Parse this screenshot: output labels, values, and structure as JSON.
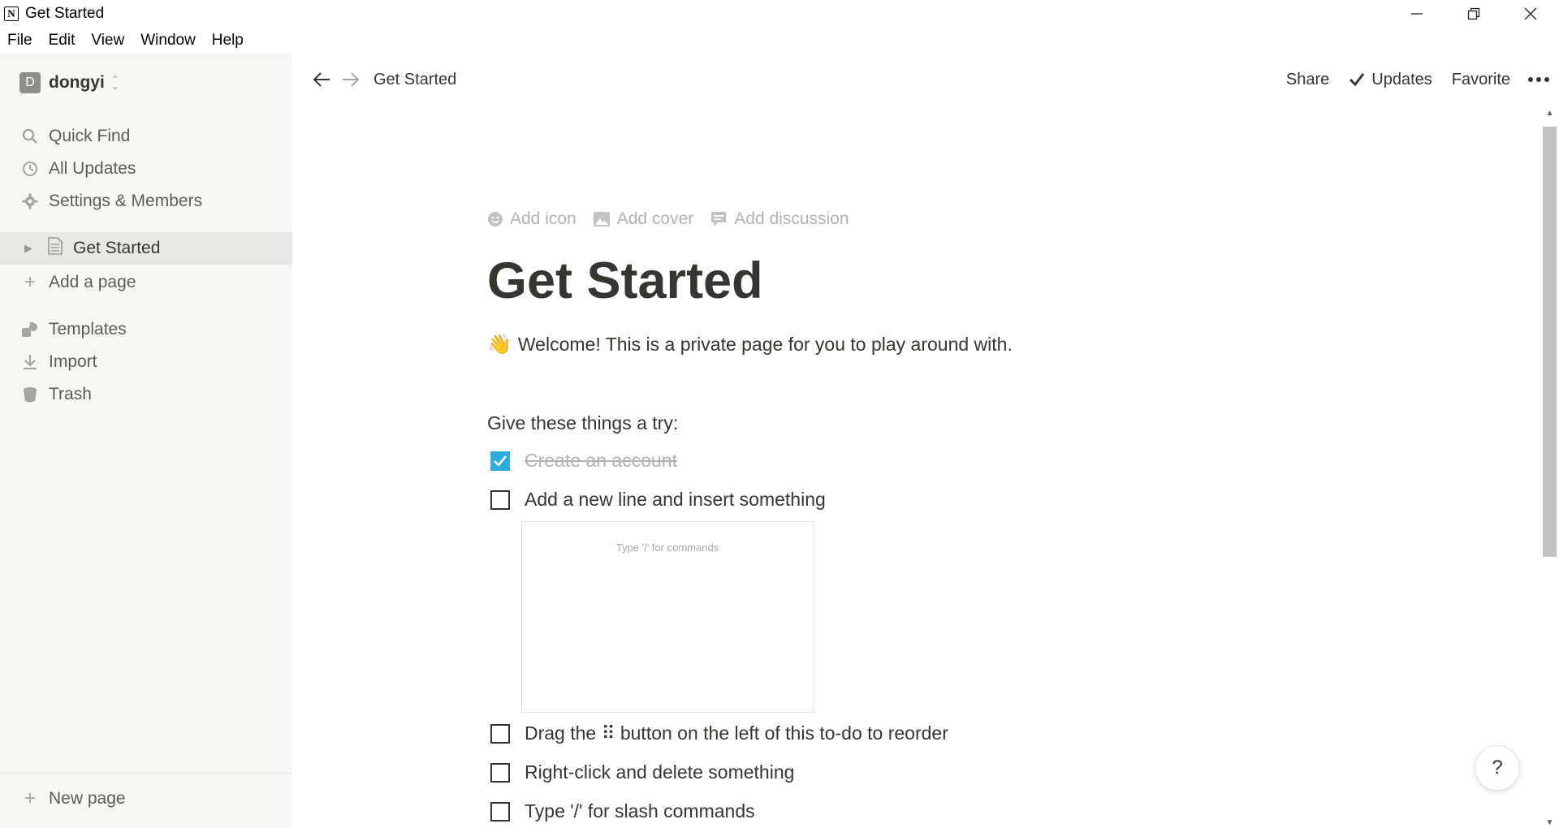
{
  "window": {
    "app_logo": "N",
    "title": "Get Started",
    "controls": [
      "minimize-icon",
      "restore-icon",
      "close-icon"
    ]
  },
  "menubar": {
    "items": [
      "File",
      "Edit",
      "View",
      "Window",
      "Help"
    ]
  },
  "sidebar": {
    "workspace": {
      "avatar_letter": "D",
      "name": "dongyi"
    },
    "top_items": [
      {
        "label": "Quick Find",
        "icon": "search-icon"
      },
      {
        "label": "All Updates",
        "icon": "clock-icon"
      },
      {
        "label": "Settings & Members",
        "icon": "gear-icon"
      }
    ],
    "pages": [
      {
        "label": "Get Started",
        "icon": "page-icon",
        "active": true
      }
    ],
    "add_page_label": "Add a page",
    "bottom_items": [
      {
        "label": "Templates",
        "icon": "templates-icon"
      },
      {
        "label": "Import",
        "icon": "import-icon"
      },
      {
        "label": "Trash",
        "icon": "trash-icon"
      }
    ],
    "new_page_label": "New page"
  },
  "topbar": {
    "breadcrumb": "Get Started",
    "share": "Share",
    "updates": "Updates",
    "favorite": "Favorite"
  },
  "page": {
    "hints": {
      "add_icon": "Add icon",
      "add_cover": "Add cover",
      "add_discussion": "Add discussion"
    },
    "title": "Get Started",
    "welcome_emoji": "👋",
    "welcome_text": "Welcome! This is a private page for you to play around with.",
    "try_label": "Give these things a try:",
    "todos": [
      {
        "text": "Create an account",
        "checked": true
      },
      {
        "text": "Add a new line and insert something",
        "checked": false
      },
      {
        "text": "Drag the ⠿ button on the left of this to-do to reorder",
        "checked": false
      },
      {
        "text": "Right-click and delete something",
        "checked": false
      },
      {
        "text": "Type '/' for slash commands",
        "checked": false
      }
    ],
    "embed_placeholder": "Type '/' for commands"
  },
  "help_label": "?",
  "colors": {
    "sidebar_bg": "#f7f6f3",
    "text": "#37352f",
    "checkbox_accent": "#2eaadc"
  }
}
